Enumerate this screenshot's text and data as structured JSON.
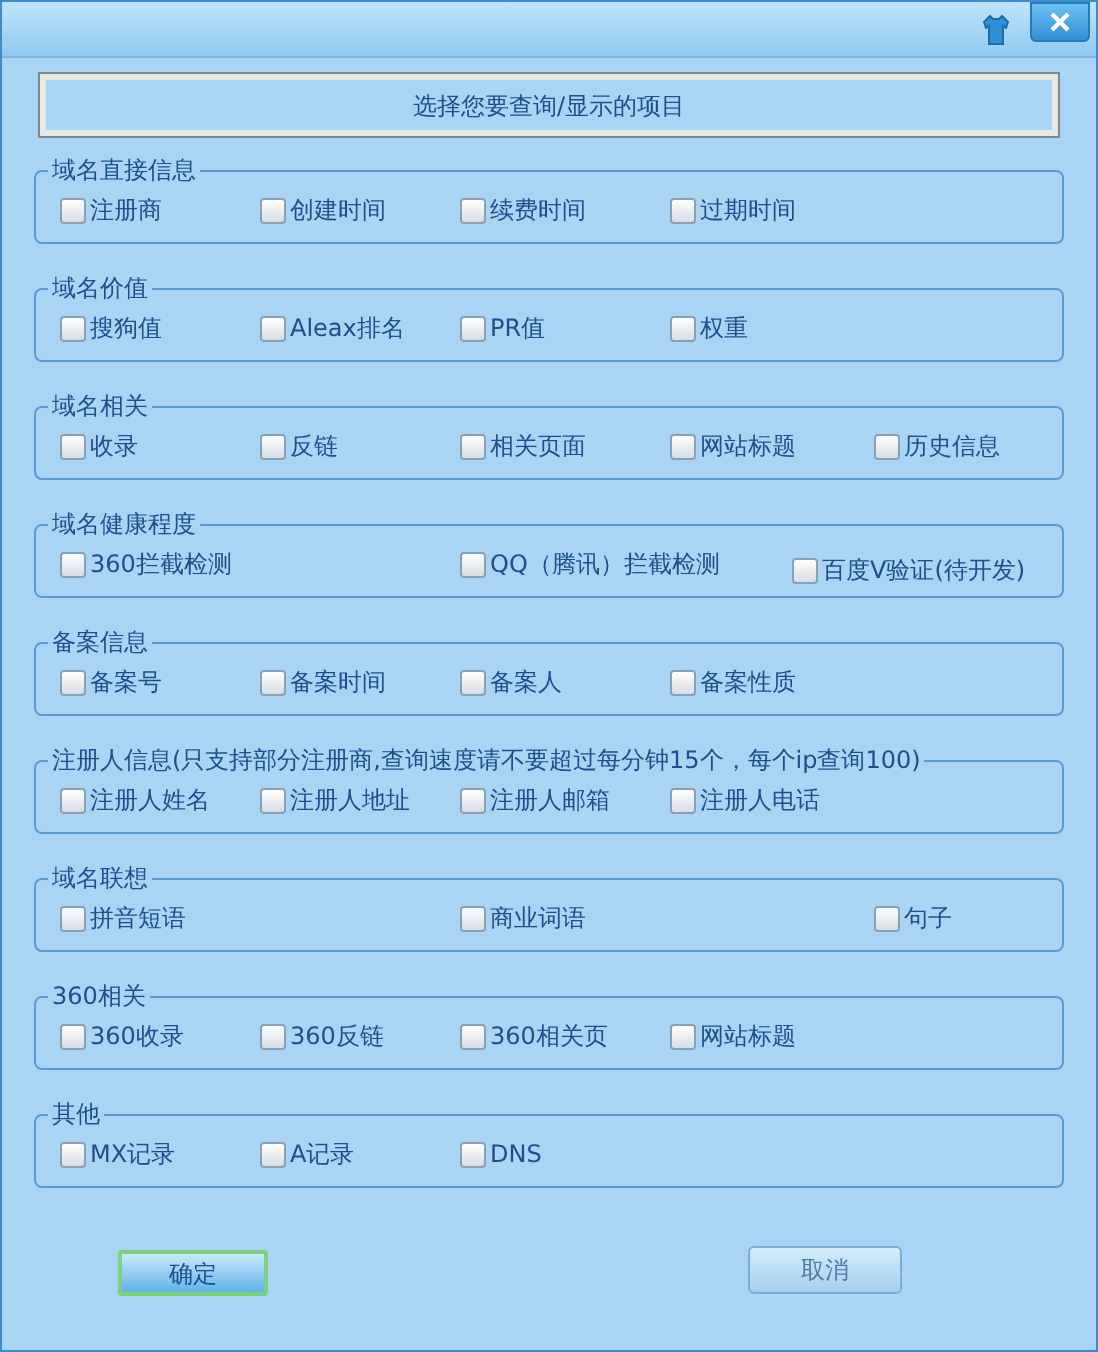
{
  "header": "选择您要查询/显示的项目",
  "groups": [
    {
      "legend": "域名直接信息",
      "items": [
        {
          "label": "注册商",
          "checked": false
        },
        {
          "label": "创建时间",
          "checked": false
        },
        {
          "label": "续费时间",
          "checked": false
        },
        {
          "label": "过期时间",
          "checked": false
        }
      ]
    },
    {
      "legend": "域名价值",
      "items": [
        {
          "label": "搜狗值",
          "checked": false
        },
        {
          "label": "Aleax排名",
          "checked": false
        },
        {
          "label": "PR值",
          "checked": false
        },
        {
          "label": "权重",
          "checked": false
        }
      ]
    },
    {
      "legend": "域名相关",
      "items": [
        {
          "label": "收录",
          "checked": false
        },
        {
          "label": "反链",
          "checked": false
        },
        {
          "label": "相关页面",
          "checked": false
        },
        {
          "label": "网站标题",
          "checked": false
        },
        {
          "label": "历史信息",
          "checked": false
        }
      ]
    },
    {
      "legend": "域名健康程度",
      "items": [
        {
          "label": "360拦截检测",
          "checked": false
        },
        {
          "label": "QQ（腾讯）拦截检测",
          "checked": false
        },
        {
          "label": "百度V验证(待开发)",
          "checked": false
        }
      ]
    },
    {
      "legend": "备案信息",
      "items": [
        {
          "label": "备案号",
          "checked": false
        },
        {
          "label": "备案时间",
          "checked": false
        },
        {
          "label": "备案人",
          "checked": false
        },
        {
          "label": "备案性质",
          "checked": false
        }
      ]
    },
    {
      "legend": "注册人信息(只支持部分注册商,查询速度请不要超过每分钟15个，每个ip查询100)",
      "items": [
        {
          "label": "注册人姓名",
          "checked": false
        },
        {
          "label": "注册人地址",
          "checked": false
        },
        {
          "label": "注册人邮箱",
          "checked": false
        },
        {
          "label": "注册人电话",
          "checked": false
        }
      ]
    },
    {
      "legend": "域名联想",
      "items": [
        {
          "label": "拼音短语",
          "checked": false
        },
        {
          "label": "商业词语",
          "checked": false
        },
        {
          "label": "句子",
          "checked": false
        }
      ]
    },
    {
      "legend": "360相关",
      "items": [
        {
          "label": "360收录",
          "checked": false
        },
        {
          "label": "360反链",
          "checked": false
        },
        {
          "label": "360相关页",
          "checked": false
        },
        {
          "label": "网站标题",
          "checked": false
        }
      ]
    },
    {
      "legend": "其他",
      "items": [
        {
          "label": "MX记录",
          "checked": false
        },
        {
          "label": "A记录",
          "checked": false
        },
        {
          "label": "DNS",
          "checked": false
        }
      ]
    }
  ],
  "buttons": [
    {
      "label": "确定",
      "kind": "primary"
    },
    {
      "label": "取消",
      "kind": "secondary"
    }
  ]
}
